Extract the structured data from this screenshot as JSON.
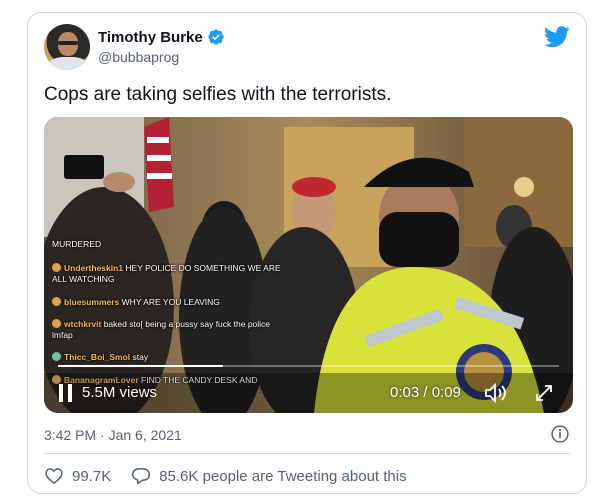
{
  "tweet": {
    "author_name": "Timothy Burke",
    "handle": "@bubbaprog",
    "text": "Cops are taking selfies with the terrorists.",
    "timestamp": "3:42 PM · Jan 6, 2021"
  },
  "video": {
    "views": "5.5M views",
    "time": "0:03 / 0:09",
    "progress": 0.33,
    "chat": [
      {
        "user": "",
        "message": "MURDERED"
      },
      {
        "user": "Undertheskin1",
        "message": "HEY POLICE DO SOMETHING WE ARE ALL WATCHING"
      },
      {
        "user": "bluesummers",
        "message": "WHY ARE YOU LEAVING"
      },
      {
        "user": "wtchkrvit",
        "message": "baked sto[ being a pussy say fuck the police lmfap"
      },
      {
        "user": "Thicc_Boi_Smol",
        "message": "stay"
      },
      {
        "user": "BananagramLover",
        "message": "FIND THE CANDY DESK AND"
      }
    ]
  },
  "footer": {
    "likes": "99.7K",
    "conversation": "85.6K people are Tweeting about this"
  },
  "colors": {
    "twitter_blue": "#1d9bf0",
    "like_red": "#f91880",
    "secondary_text": "#536471"
  },
  "icons": [
    "verified-badge-icon",
    "twitter-bird-icon",
    "play-pause-icon",
    "volume-icon",
    "fullscreen-icon",
    "info-icon",
    "heart-icon",
    "reply-icon"
  ]
}
